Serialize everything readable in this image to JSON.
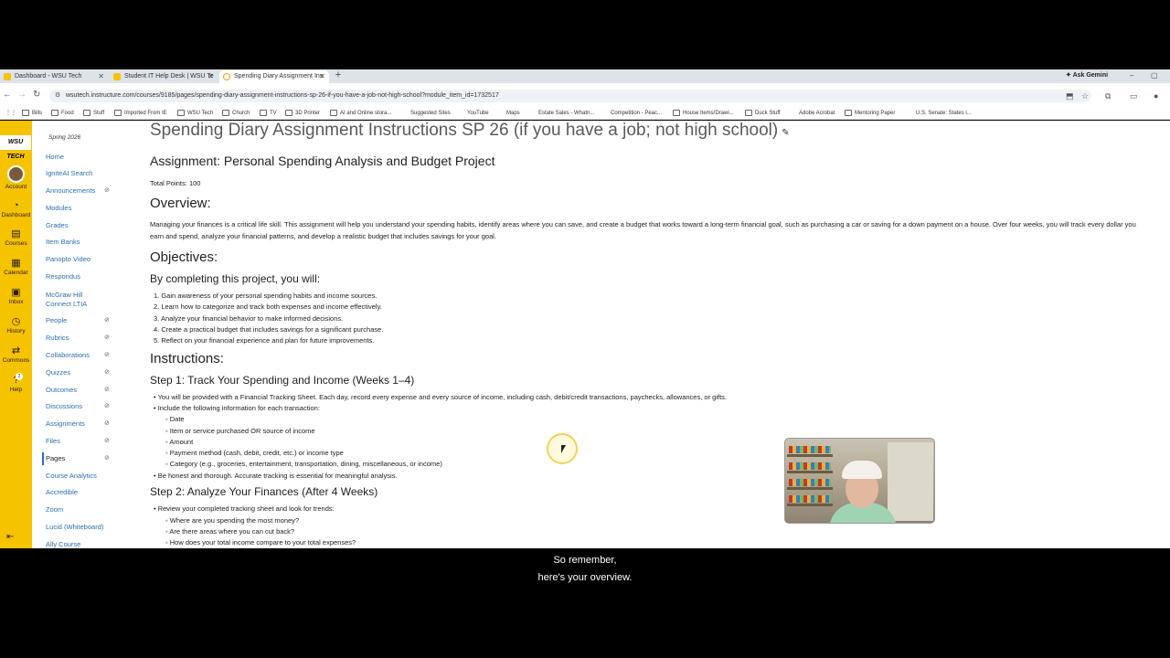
{
  "browser": {
    "tabs": [
      {
        "label": "Dashboard - WSU Tech",
        "color": "#f6c300"
      },
      {
        "label": "Student IT Help Desk | WSU Te",
        "color": "#f6c300"
      },
      {
        "label": "Spending Diary Assignment Ins",
        "color": "#e8a020"
      }
    ],
    "new_tab": "+",
    "gemini": "Ask Gemini",
    "url": "wsutech.instructure.com/courses/9185/pages/spending-diary-assignment-instructions-sp-26-if-you-have-a-job-not-high-school?module_item_id=1732517",
    "bookmarks": [
      "Bills",
      "Food",
      "Stuff",
      "Imported From IE",
      "WSU Tech",
      "Church",
      "TV",
      "3D Printer",
      "AI and Online stora...",
      "Suggested Sites",
      "YouTube",
      "Maps",
      "Estate Sales - Whatn...",
      "Competition - Peac...",
      "House Items/Drawi...",
      "Duck Stuff",
      "Adobe Acrobat",
      "Mentoring Paper",
      "U.S. Senate: States i..."
    ]
  },
  "global_nav": {
    "logo": "WSU TECH",
    "items": [
      "Account",
      "Dashboard",
      "Courses",
      "Calendar",
      "Inbox",
      "History",
      "Commons",
      "Help"
    ],
    "help_badge": "2"
  },
  "course_nav": {
    "term": "Spring 2026",
    "links": [
      "Home",
      "IgniteAI Search",
      "Announcements",
      "Modules",
      "Grades",
      "Item Banks",
      "Panopto Video",
      "McGraw Hill",
      "Connect LTIA",
      "Respondus",
      "People",
      "Rubrics",
      "Collaborations",
      "Quizzes",
      "Outcomes",
      "Discussions",
      "Assignments",
      "Files",
      "Pages",
      "Course Analytics",
      "Accredible",
      "Zoom",
      "Lucid (Whiteboard)",
      "Ally Course"
    ]
  },
  "content": {
    "page_title": "Spending Diary Assignment Instructions SP 26 (if you have a job; not high school)",
    "assignment_heading": "Assignment: Personal Spending Analysis and Budget Project",
    "total_points": "Total Points: 100",
    "overview_heading": "Overview:",
    "overview_text": "Managing your finances is a critical life skill. This assignment will help you understand your spending habits, identify areas where you can save, and create a budget that works toward a long-term financial goal, such as purchasing a car or saving for a down payment on a house. Over four weeks, you will track every dollar you earn and spend, analyze your financial patterns, and develop a realistic budget that includes savings for your goal.",
    "objectives_heading": "Objectives:",
    "objectives_intro": "By completing this project, you will:",
    "objectives": [
      "Gain awareness of your personal spending habits and income sources.",
      "Learn how to categorize and track both expenses and income effectively.",
      "Analyze your financial behavior to make informed decisions.",
      "Create a practical budget that includes savings for a significant purchase.",
      "Reflect on your financial experience and plan for future improvements."
    ],
    "instructions_heading": "Instructions:",
    "step1_heading": "Step 1: Track Your Spending and Income (Weeks 1–4)",
    "step1_items": [
      "You will be provided with a Financial Tracking Sheet. Each day, record every expense and every source of income, including cash, debit/credit transactions, paychecks, allowances, or gifts.",
      "Include the following information for each transaction:"
    ],
    "step1_subitems": [
      "Date",
      "Item or service purchased OR source of income",
      "Amount",
      "Payment method (cash, debit, credit, etc.) or income type",
      "Category (e.g., groceries, entertainment, transportation, dining, miscellaneous, or income)"
    ],
    "step1_last": "Be honest and thorough. Accurate tracking is essential for meaningful analysis.",
    "step2_heading": "Step 2: Analyze Your Finances (After 4 Weeks)",
    "step2_item": "Review your completed tracking sheet and look for trends:",
    "step2_subitems": [
      "Where are you spending the most money?",
      "Are there areas where you can cut back?",
      "How does your total income compare to your total expenses?"
    ]
  },
  "caption": {
    "line1": "So remember,",
    "line2": "here's your overview."
  }
}
